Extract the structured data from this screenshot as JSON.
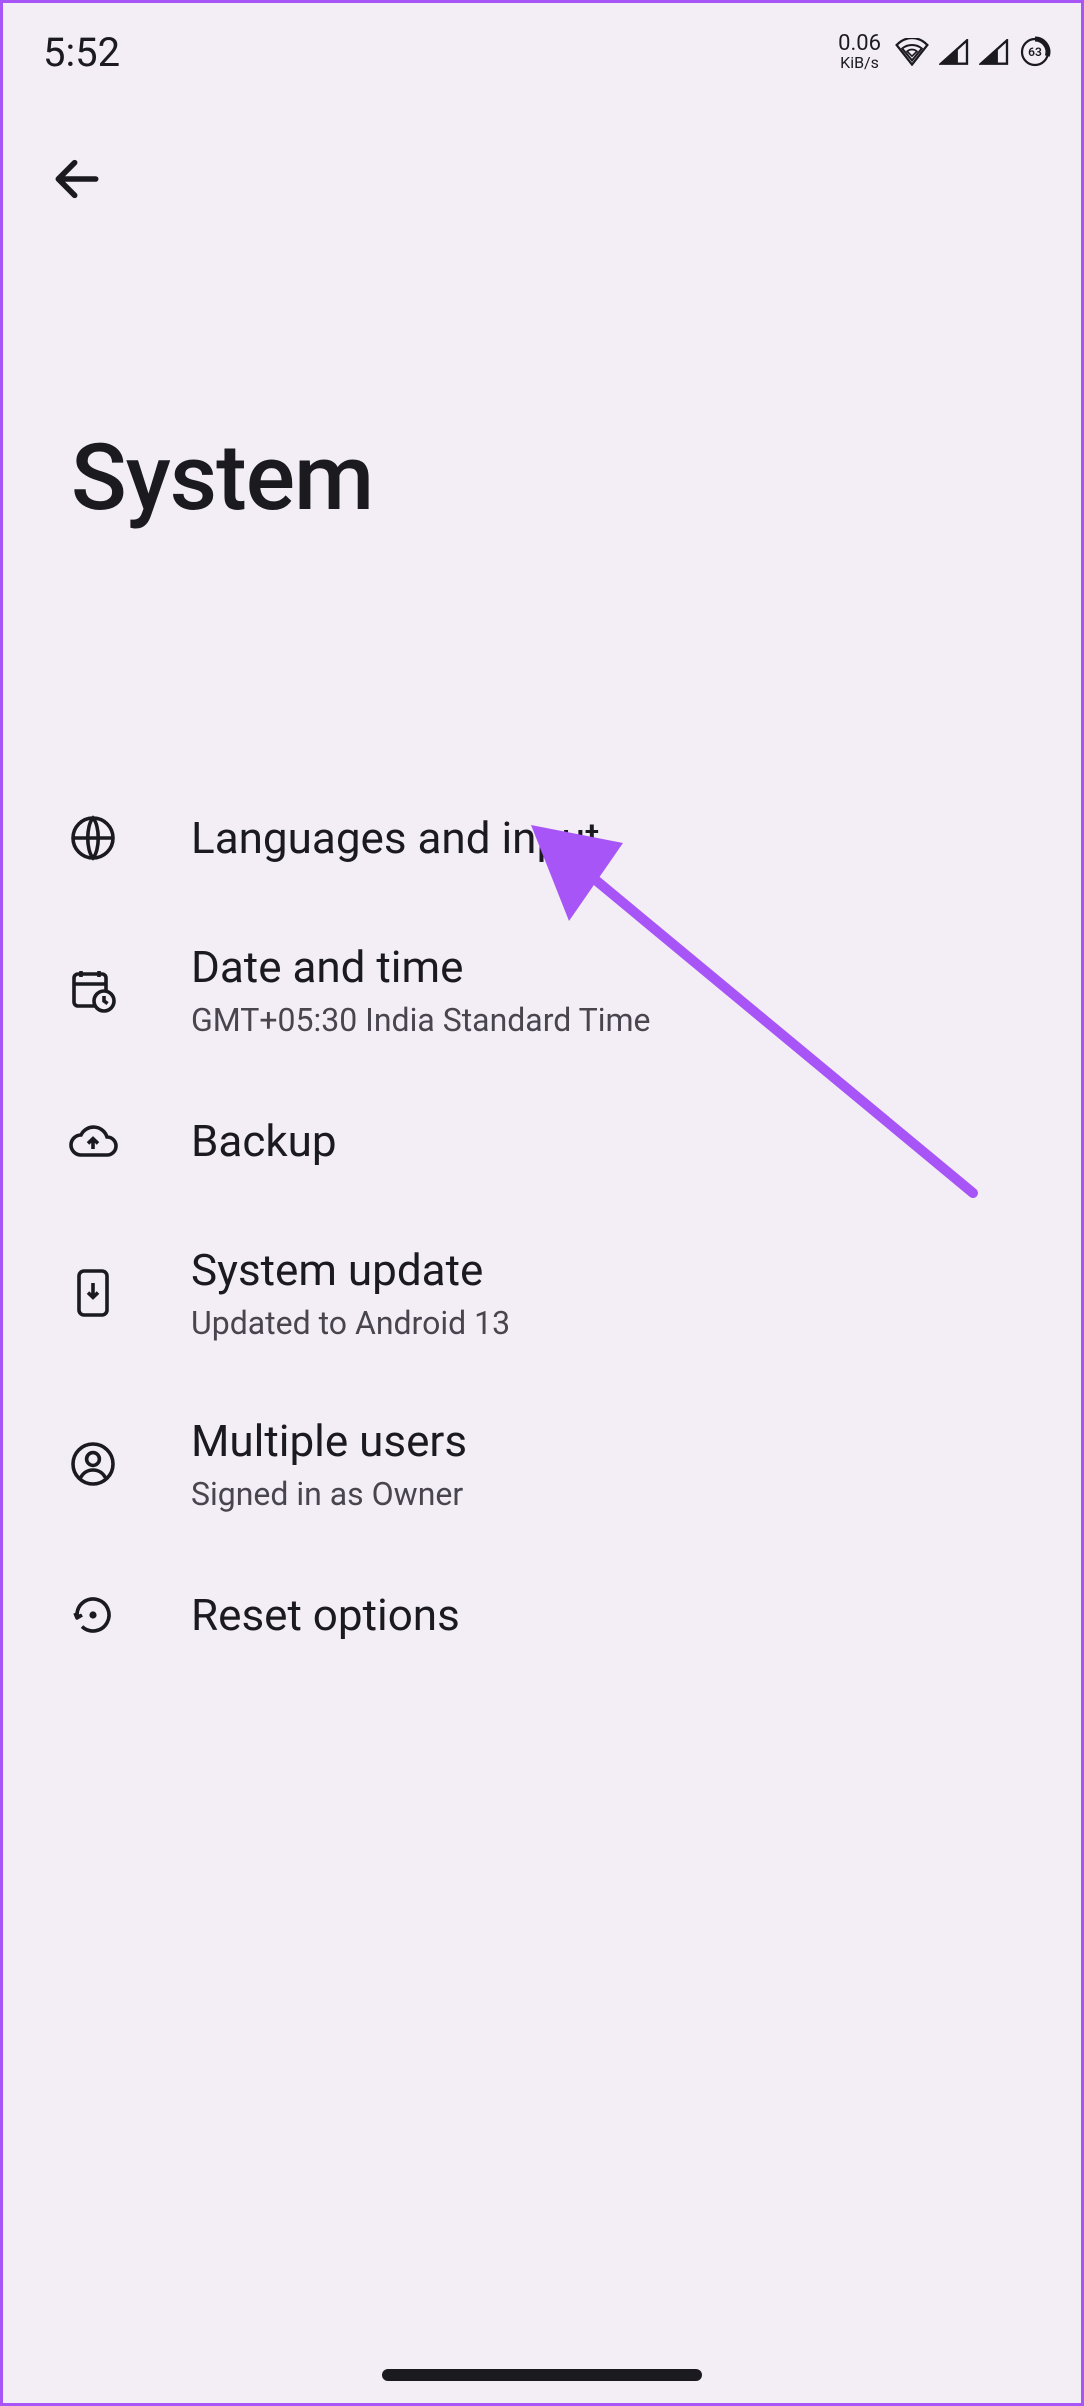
{
  "status_bar": {
    "time": "5:52",
    "net_speed_value": "0.06",
    "net_speed_unit": "KiB/s",
    "battery_percent": "63"
  },
  "header": {
    "title": "System"
  },
  "settings": [
    {
      "icon": "globe-icon",
      "title": "Languages and input",
      "subtitle": ""
    },
    {
      "icon": "calendar-clock-icon",
      "title": "Date and time",
      "subtitle": "GMT+05:30 India Standard Time"
    },
    {
      "icon": "cloud-upload-icon",
      "title": "Backup",
      "subtitle": ""
    },
    {
      "icon": "phone-download-icon",
      "title": "System update",
      "subtitle": "Updated to Android 13"
    },
    {
      "icon": "user-circle-icon",
      "title": "Multiple users",
      "subtitle": "Signed in as Owner"
    },
    {
      "icon": "reset-icon",
      "title": "Reset options",
      "subtitle": ""
    }
  ],
  "annotation": {
    "arrow_color": "#a855f7"
  }
}
